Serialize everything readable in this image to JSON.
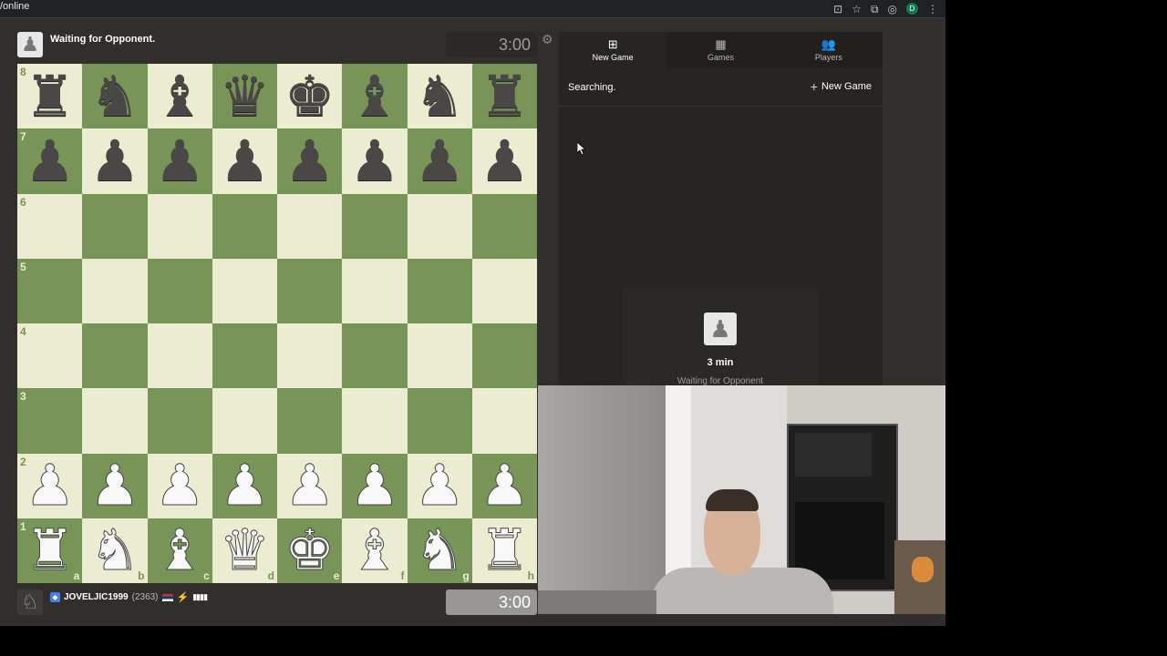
{
  "browser": {
    "url": "/online",
    "profile_initial": "D"
  },
  "top_player": {
    "status": "Waiting for Opponent.",
    "clock": "3:00"
  },
  "bottom_player": {
    "name": "JOVELJIC1999",
    "rating": "(2363)",
    "clock": "3:00"
  },
  "panel": {
    "tabs": [
      {
        "label": "New Game",
        "icon": "plus-square-icon"
      },
      {
        "label": "Games",
        "icon": "board-icon"
      },
      {
        "label": "Players",
        "icon": "players-icon"
      }
    ],
    "searching": "Searching.",
    "new_game_link": "New Game",
    "waiting_card": {
      "time": "3 min",
      "text": "Waiting for Opponent"
    }
  },
  "board": {
    "ranks": [
      "8",
      "7",
      "6",
      "5",
      "4",
      "3",
      "2",
      "1"
    ],
    "files": [
      "a",
      "b",
      "c",
      "d",
      "e",
      "f",
      "g",
      "h"
    ],
    "position": [
      [
        "br",
        "bn",
        "bb",
        "bq",
        "bk",
        "bb",
        "bn",
        "br"
      ],
      [
        "bp",
        "bp",
        "bp",
        "bp",
        "bp",
        "bp",
        "bp",
        "bp"
      ],
      [
        "",
        "",
        "",
        "",
        "",
        "",
        "",
        ""
      ],
      [
        "",
        "",
        "",
        "",
        "",
        "",
        "",
        ""
      ],
      [
        "",
        "",
        "",
        "",
        "",
        "",
        "",
        ""
      ],
      [
        "",
        "",
        "",
        "",
        "",
        "",
        "",
        ""
      ],
      [
        "wp",
        "wp",
        "wp",
        "wp",
        "wp",
        "wp",
        "wp",
        "wp"
      ],
      [
        "wr",
        "wn",
        "wb",
        "wq",
        "wk",
        "wb",
        "wn",
        "wr"
      ]
    ]
  }
}
